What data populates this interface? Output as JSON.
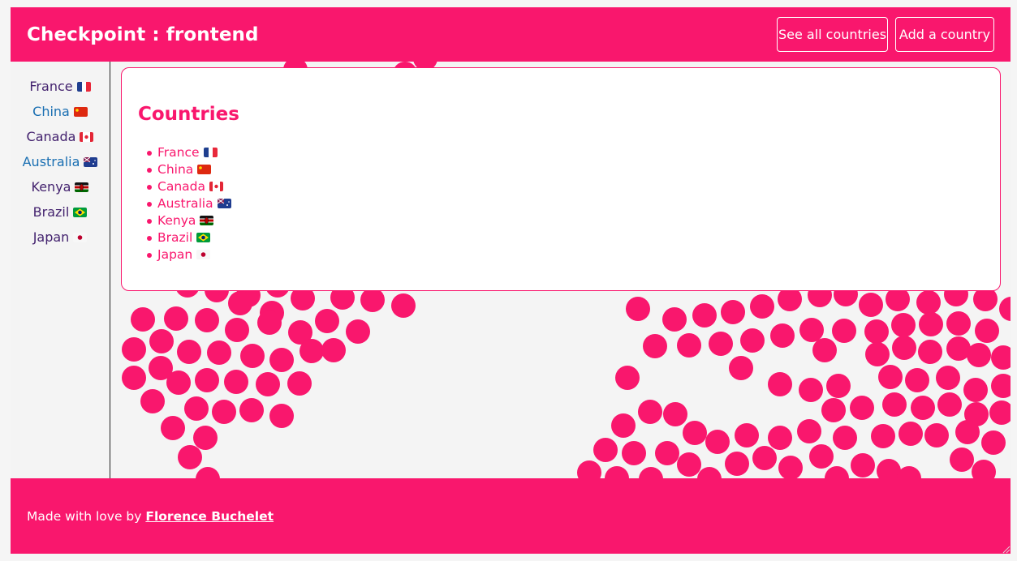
{
  "header": {
    "title": "Checkpoint : frontend",
    "nav": [
      {
        "label": "See all countries"
      },
      {
        "label": "Add a country"
      }
    ]
  },
  "sidebar": {
    "items": [
      {
        "label": "France",
        "flag": "flag-france",
        "color": "#43226e"
      },
      {
        "label": "China",
        "flag": "flag-china",
        "color": "#1a6fb2"
      },
      {
        "label": "Canada",
        "flag": "flag-canada",
        "color": "#43226e"
      },
      {
        "label": "Australia",
        "flag": "flag-australia",
        "color": "#1a6fb2"
      },
      {
        "label": "Kenya",
        "flag": "flag-kenya",
        "color": "#43226e"
      },
      {
        "label": "Brazil",
        "flag": "flag-brazil",
        "color": "#43226e"
      },
      {
        "label": "Japan",
        "flag": "flag-japan",
        "color": "#43226e"
      }
    ]
  },
  "main": {
    "heading": "Countries",
    "countries": [
      {
        "label": "France",
        "flag": "flag-france"
      },
      {
        "label": "China",
        "flag": "flag-china"
      },
      {
        "label": "Canada",
        "flag": "flag-canada"
      },
      {
        "label": "Australia",
        "flag": "flag-australia"
      },
      {
        "label": "Kenya",
        "flag": "flag-kenya"
      },
      {
        "label": "Brazil",
        "flag": "flag-brazil"
      },
      {
        "label": "Japan",
        "flag": "flag-japan"
      }
    ]
  },
  "footer": {
    "prefix": "Made with love by",
    "author": "Florence Buchelet"
  },
  "colors": {
    "accent": "#f9176d",
    "background": "#f4f4f4",
    "visited_link": "#43226e",
    "link": "#1a6fb2"
  }
}
